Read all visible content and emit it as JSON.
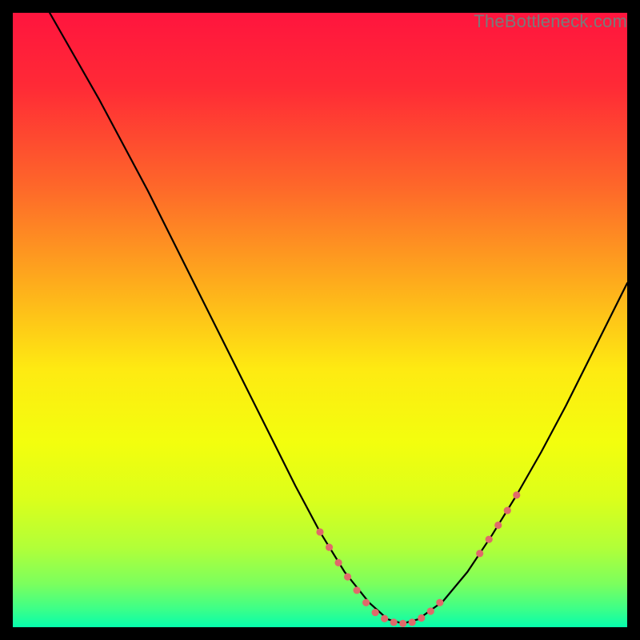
{
  "watermark": "TheBottleneck.com",
  "chart_data": {
    "type": "line",
    "title": "",
    "xlabel": "",
    "ylabel": "",
    "xlim": [
      0,
      100
    ],
    "ylim": [
      0,
      100
    ],
    "grid": false,
    "legend": false,
    "gradient_stops": [
      {
        "offset": 0.0,
        "color": "#ff153e"
      },
      {
        "offset": 0.12,
        "color": "#ff2a36"
      },
      {
        "offset": 0.28,
        "color": "#fe662a"
      },
      {
        "offset": 0.44,
        "color": "#feac1c"
      },
      {
        "offset": 0.58,
        "color": "#feea12"
      },
      {
        "offset": 0.7,
        "color": "#f3fe0e"
      },
      {
        "offset": 0.79,
        "color": "#dcff1a"
      },
      {
        "offset": 0.87,
        "color": "#b2ff38"
      },
      {
        "offset": 0.93,
        "color": "#7bff5e"
      },
      {
        "offset": 0.97,
        "color": "#3dff88"
      },
      {
        "offset": 1.0,
        "color": "#06fdac"
      }
    ],
    "series": [
      {
        "name": "curve",
        "stroke": "#000000",
        "stroke_width": 2.2,
        "x": [
          6,
          10,
          14,
          18,
          22,
          26,
          30,
          34,
          38,
          42,
          46,
          50,
          54,
          58,
          61,
          63.5,
          66,
          70,
          74,
          78,
          82,
          86,
          90,
          94,
          98,
          100
        ],
        "y": [
          100,
          93,
          86,
          78.5,
          71,
          63,
          55,
          47,
          39,
          31,
          23,
          15.5,
          9,
          4,
          1.3,
          0.6,
          1.3,
          4.2,
          9,
          15,
          21.5,
          28.5,
          36,
          44,
          52,
          56
        ]
      }
    ],
    "markers": {
      "name": "dotted-segments",
      "color": "#e06a6a",
      "radius": 4.6,
      "points": [
        {
          "x": 50.0,
          "y": 15.5
        },
        {
          "x": 51.5,
          "y": 13.0
        },
        {
          "x": 53.0,
          "y": 10.5
        },
        {
          "x": 54.5,
          "y": 8.2
        },
        {
          "x": 56.0,
          "y": 6.0
        },
        {
          "x": 57.5,
          "y": 4.0
        },
        {
          "x": 59.0,
          "y": 2.4
        },
        {
          "x": 60.5,
          "y": 1.4
        },
        {
          "x": 62.0,
          "y": 0.8
        },
        {
          "x": 63.5,
          "y": 0.6
        },
        {
          "x": 65.0,
          "y": 0.8
        },
        {
          "x": 66.5,
          "y": 1.5
        },
        {
          "x": 68.0,
          "y": 2.6
        },
        {
          "x": 69.5,
          "y": 4.0
        },
        {
          "x": 76.0,
          "y": 12.0
        },
        {
          "x": 77.5,
          "y": 14.3
        },
        {
          "x": 79.0,
          "y": 16.6
        },
        {
          "x": 80.5,
          "y": 19.0
        },
        {
          "x": 82.0,
          "y": 21.5
        }
      ]
    }
  }
}
